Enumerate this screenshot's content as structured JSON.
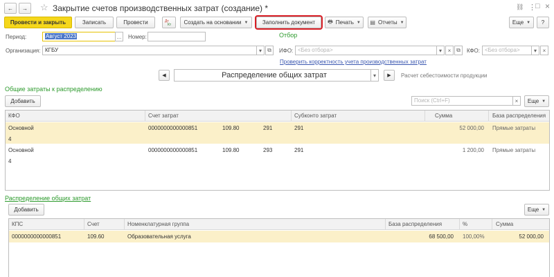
{
  "window": {
    "title": "Закрытие счетов производственных затрат (создание) *",
    "back": "←",
    "forward": "→",
    "star": "☆",
    "link_icon": "🔗",
    "more_icon": "⋮",
    "maximize": "□",
    "close": "×"
  },
  "toolbar": {
    "post_close": "Провести и закрыть",
    "save": "Записать",
    "post": "Провести",
    "create_based": "Создать на основании",
    "fill_document": "Заполнить документ",
    "print": "Печать",
    "reports": "Отчеты",
    "more": "Еще",
    "help": "?"
  },
  "form": {
    "period_label": "Период:",
    "period_value": "Август 2023",
    "period_btn": "...",
    "number_label": "Номер:",
    "number_value": "",
    "org_label": "Организация:",
    "org_value": "КГБУ",
    "filter_title": "Отбор",
    "ifo_label": "ИФО:",
    "ifo_placeholder": "<Без отбора>",
    "kfo_label": "КФО:",
    "kfo_placeholder": "<Без отбора>",
    "check_link": "Проверить корректность учета производственных затрат"
  },
  "stepper": {
    "prev": "◀",
    "next": "▶",
    "value": "Распределение общих затрат",
    "hint": "Расчет себестоимости продукции"
  },
  "general_costs": {
    "title": "Общие затраты к распределению",
    "add": "Добавить",
    "search_placeholder": "Поиск (Ctrl+F)",
    "more": "Еще",
    "columns": [
      "КФО",
      "Счет затрат",
      "Субконто затрат",
      "Сумма",
      "База распределения"
    ],
    "rows": [
      {
        "kfo": "Основной",
        "kfo2": "4",
        "account": "0000000000000851",
        "acc_a": "109.80",
        "acc_b": "291",
        "subconto": "291",
        "sum": "52 000,00",
        "base": "Прямые затраты"
      },
      {
        "kfo": "Основной",
        "kfo2": "4",
        "account": "0000000000000851",
        "acc_a": "109.80",
        "acc_b": "293",
        "subconto": "291",
        "sum": "1 200,00",
        "base": "Прямые затраты"
      }
    ]
  },
  "distribution": {
    "title": "Распределение общих затрат",
    "add": "Добавить",
    "more": "Еще",
    "columns": [
      "КПС",
      "Счет",
      "Номенклатурная группа",
      "База распределения",
      "%",
      "Сумма"
    ],
    "rows": [
      {
        "kps": "0000000000000851",
        "account": "109.60",
        "group": "Образовательная услуга",
        "base": "68 500,00",
        "percent": "100,00%",
        "sum": "52 000,00"
      }
    ]
  }
}
